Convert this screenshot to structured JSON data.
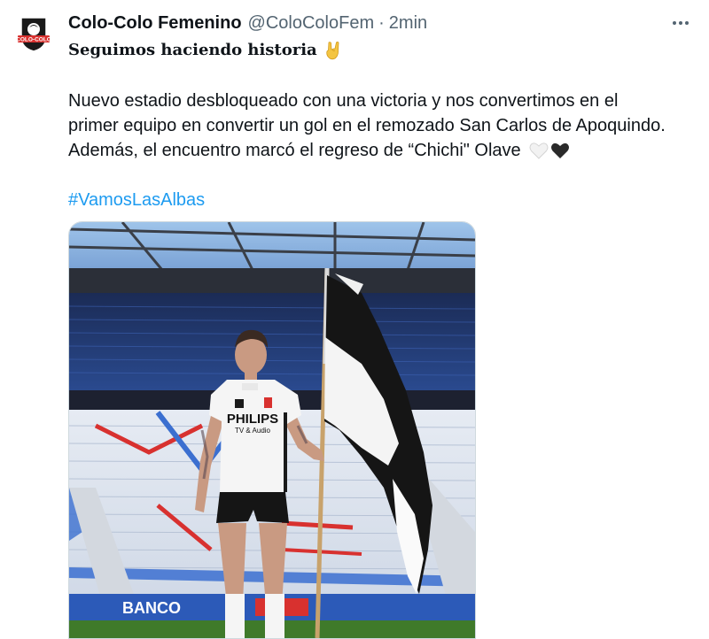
{
  "tweet": {
    "author_name": "Colo-Colo Femenino",
    "author_handle": "@ColoColoFem",
    "separator": "·",
    "time": "2min",
    "headline": "Seguimos haciendo historia",
    "headline_emoji": "rock-hand-emoji",
    "body_line1": "Nuevo estadio desbloqueado con una victoria y nos convertimos en el",
    "body_line2": "primer equipo en convertir un gol en el remozado San Carlos de Apoquindo.",
    "body_line3": "Además, el encuentro marcó el regreso de “Chichi\" Olave",
    "hearts": [
      "white-heart-emoji",
      "black-heart-emoji"
    ],
    "hashtag": "#VamosLasAlbas",
    "avatar_logo_text": "COLO-COLO"
  },
  "photo": {
    "sponsor_shirt": "PHILIPS",
    "sponsor_shirt_sub": "TV & Audio",
    "board_text": "BANCO"
  },
  "colors": {
    "link": "#1d9bf0",
    "secondary_text": "#536471",
    "stadium_seat_blue": "#3b6fd0",
    "stadium_red": "#d8312f"
  }
}
